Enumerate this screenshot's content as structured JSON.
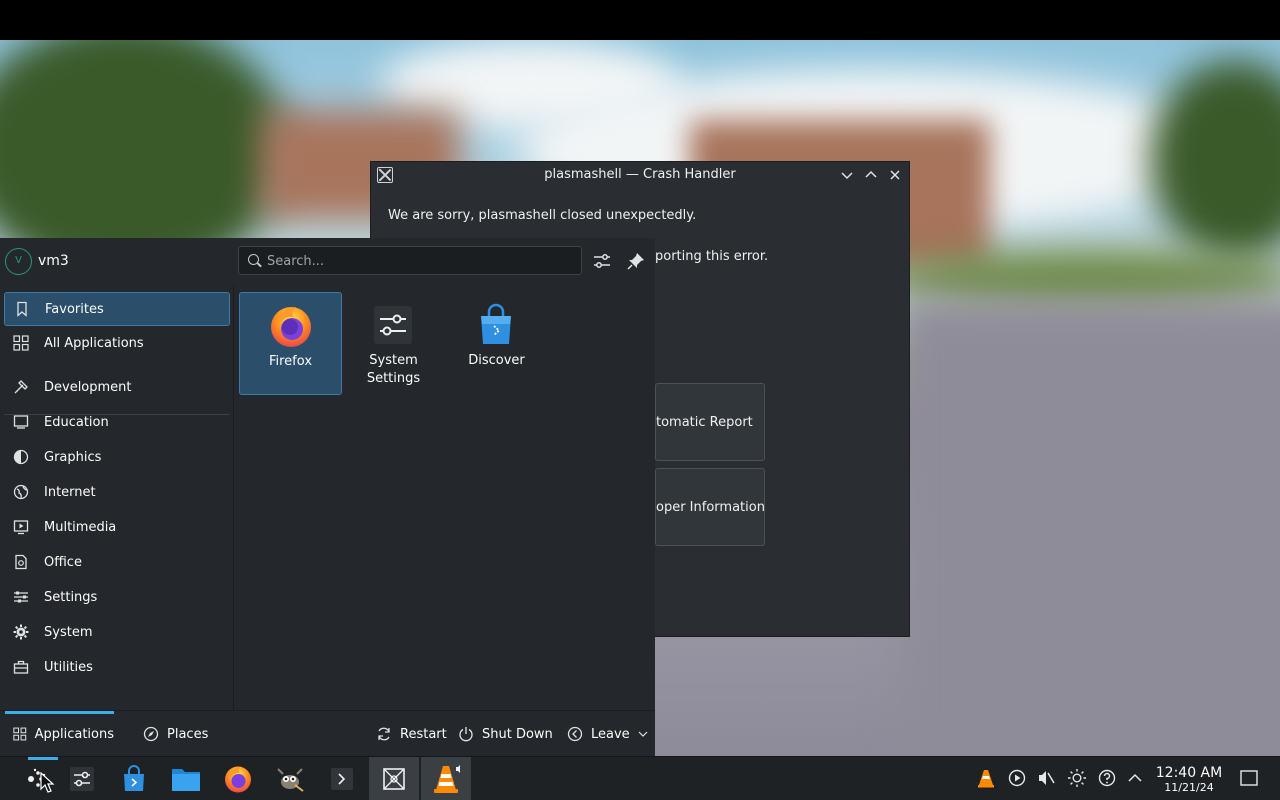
{
  "crash_dialog": {
    "title": "plasmashell — Crash Handler",
    "message": "We are sorry, plasmashell closed unexpectedly.",
    "partial_message": "porting this error.",
    "buttons": [
      "tomatic Report",
      "oper Information"
    ]
  },
  "launcher": {
    "user": {
      "avatar_initial": "V",
      "name": "vm3"
    },
    "search": {
      "placeholder": "Search...",
      "value": ""
    },
    "categories": [
      {
        "label": "Favorites",
        "icon": "bookmark-icon",
        "active": true
      },
      {
        "label": "All Applications",
        "icon": "grid-icon",
        "active": false
      },
      {
        "label": "Development",
        "icon": "hammer-icon",
        "active": false
      },
      {
        "label": "Education",
        "icon": "monitor-icon",
        "active": false
      },
      {
        "label": "Graphics",
        "icon": "palette-icon",
        "active": false
      },
      {
        "label": "Internet",
        "icon": "globe-icon",
        "active": false
      },
      {
        "label": "Multimedia",
        "icon": "multimedia-icon",
        "active": false
      },
      {
        "label": "Office",
        "icon": "document-icon",
        "active": false
      },
      {
        "label": "Settings",
        "icon": "sliders-icon",
        "active": false
      },
      {
        "label": "System",
        "icon": "gear-icon",
        "active": false
      },
      {
        "label": "Utilities",
        "icon": "toolbox-icon",
        "active": false
      }
    ],
    "favorites": [
      {
        "label": "Firefox",
        "icon": "firefox-icon",
        "active": true
      },
      {
        "label": "System\nSettings",
        "icon": "system-settings-icon",
        "active": false
      },
      {
        "label": "Discover",
        "icon": "discover-icon",
        "active": false
      }
    ],
    "footer": {
      "tabs": [
        {
          "label": "Applications",
          "icon": "grid-icon",
          "active": true
        },
        {
          "label": "Places",
          "icon": "compass-icon",
          "active": false
        }
      ],
      "actions": [
        {
          "label": "Restart",
          "icon": "restart-icon"
        },
        {
          "label": "Shut Down",
          "icon": "power-icon"
        },
        {
          "label": "Leave",
          "icon": "leave-icon"
        }
      ]
    }
  },
  "taskbar": {
    "apps": [
      {
        "name": "application-launcher",
        "icon": "kde-launcher-icon"
      },
      {
        "name": "system-settings",
        "icon": "sliders-icon"
      },
      {
        "name": "discover",
        "icon": "discover-icon"
      },
      {
        "name": "dolphin",
        "icon": "folder-icon"
      },
      {
        "name": "firefox",
        "icon": "firefox-icon"
      },
      {
        "name": "gimp",
        "icon": "gimp-icon"
      },
      {
        "name": "konsole",
        "icon": "terminal-icon"
      },
      {
        "name": "crash-handler",
        "icon": "crash-icon"
      },
      {
        "name": "vlc",
        "icon": "vlc-icon"
      }
    ],
    "tray": [
      "vlc-tray-icon",
      "media-play-icon",
      "volume-muted-icon",
      "brightness-icon",
      "help-icon",
      "chevron-up-icon"
    ],
    "clock": {
      "time": "12:40 AM",
      "date": "11/21/24"
    }
  },
  "colors": {
    "accent": "#3daee9",
    "selection": "#2b4f6b",
    "panel": "#24282c"
  }
}
